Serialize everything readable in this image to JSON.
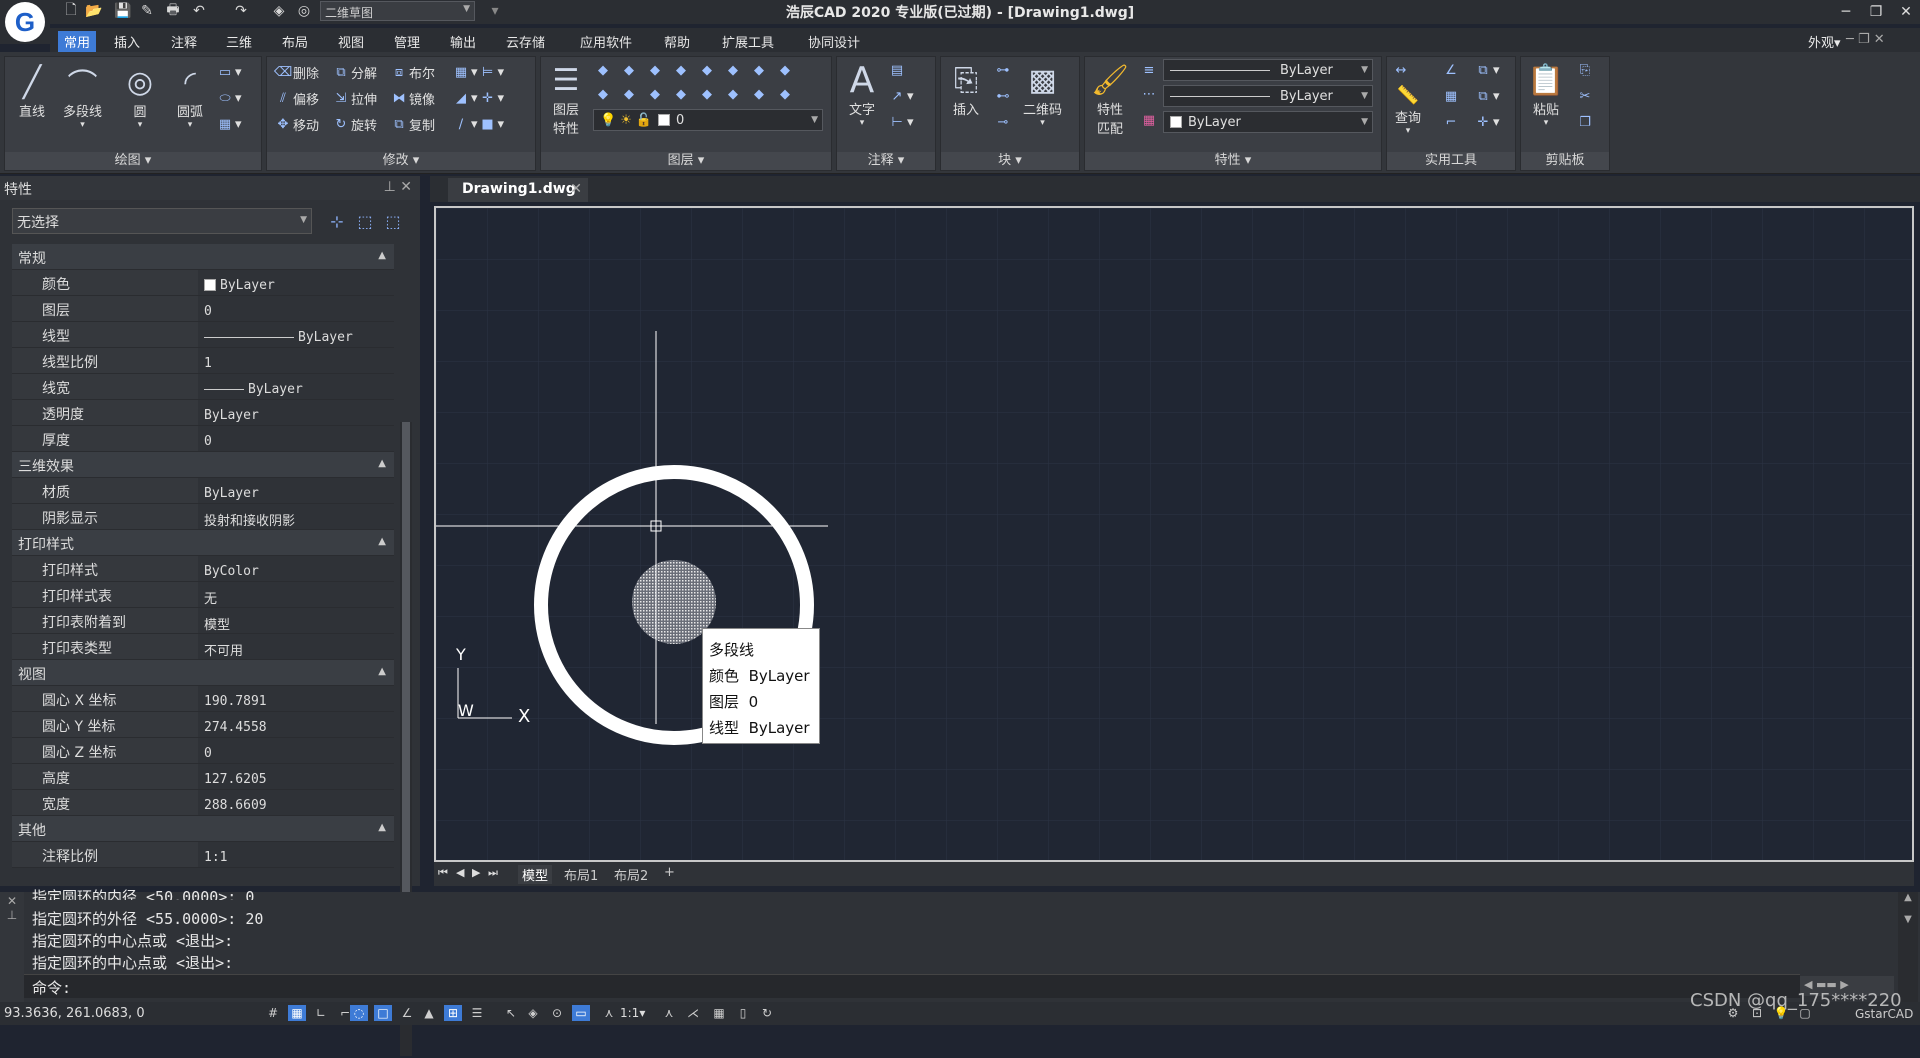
{
  "titlebar": {
    "workspace": "二维草图",
    "title": "浩辰CAD 2020 专业版(已过期) - [Drawing1.dwg]"
  },
  "menus": [
    "常用",
    "插入",
    "注释",
    "三维",
    "布局",
    "视图",
    "管理",
    "输出",
    "云存储",
    "应用软件",
    "帮助",
    "扩展工具",
    "协同设计"
  ],
  "menu_right": "外观",
  "ribbon": {
    "draw": {
      "line": "直线",
      "polyline": "多段线",
      "circle": "圆",
      "arc": "圆弧",
      "title": "绘图"
    },
    "modify": {
      "erase": "删除",
      "explode": "分解",
      "boolean": "布尔",
      "offset": "偏移",
      "stretch": "拉伸",
      "mirror": "镜像",
      "move": "移动",
      "rotate": "旋转",
      "copy": "复制",
      "title": "修改"
    },
    "layer": {
      "props_l1": "图层",
      "props_l2": "特性",
      "current": "0",
      "title": "图层"
    },
    "annotate": {
      "text": "文字",
      "title": "注释"
    },
    "block": {
      "insert": "插入",
      "qrcode": "二维码",
      "title": "块"
    },
    "properties": {
      "match_l1": "特性",
      "match_l2": "匹配",
      "linetype1": "ByLayer",
      "linetype2": "ByLayer",
      "color": "ByLayer",
      "title": "特性"
    },
    "utilities": {
      "query": "查询",
      "title": "实用工具"
    },
    "clipboard": {
      "paste": "粘贴",
      "title": "剪贴板"
    }
  },
  "props_panel": {
    "title": "特性",
    "selection": "无选择",
    "sections": {
      "general": "常规",
      "effect3d": "三维效果",
      "plotstyle": "打印样式",
      "view": "视图",
      "misc": "其他"
    },
    "general": [
      {
        "k": "颜色",
        "v": "ByLayer"
      },
      {
        "k": "图层",
        "v": "0"
      },
      {
        "k": "线型",
        "v": "ByLayer"
      },
      {
        "k": "线型比例",
        "v": "1"
      },
      {
        "k": "线宽",
        "v": "ByLayer"
      },
      {
        "k": "透明度",
        "v": "ByLayer"
      },
      {
        "k": "厚度",
        "v": "0"
      }
    ],
    "effect3d": [
      {
        "k": "材质",
        "v": "ByLayer"
      },
      {
        "k": "阴影显示",
        "v": "投射和接收阴影"
      }
    ],
    "plotstyle": [
      {
        "k": "打印样式",
        "v": "ByColor"
      },
      {
        "k": "打印样式表",
        "v": "无"
      },
      {
        "k": "打印表附着到",
        "v": "模型"
      },
      {
        "k": "打印表类型",
        "v": "不可用"
      }
    ],
    "view": [
      {
        "k": "圆心 X 坐标",
        "v": "190.7891"
      },
      {
        "k": "圆心 Y 坐标",
        "v": "274.4558"
      },
      {
        "k": "圆心 Z 坐标",
        "v": "0"
      },
      {
        "k": "高度",
        "v": "127.6205"
      },
      {
        "k": "宽度",
        "v": "288.6609"
      }
    ],
    "misc": [
      {
        "k": "注释比例",
        "v": "1:1"
      }
    ]
  },
  "doc_tab": "Drawing1.dwg",
  "tooltip": {
    "type": "多段线",
    "color_k": "颜色",
    "color_v": "ByLayer",
    "layer_k": "图层",
    "layer_v": "0",
    "linetype_k": "线型",
    "linetype_v": "ByLayer"
  },
  "ucs": {
    "y": "Y",
    "w": "W",
    "x": "X"
  },
  "layout_tabs": [
    "模型",
    "布局1",
    "布局2",
    "+"
  ],
  "command": {
    "line0": "指定圆环的内径 <50.0000>: 0",
    "line1": "指定圆环的外径 <55.0000>: 20",
    "line2": "指定圆环的中心点或 <退出>:",
    "line3": "指定圆环的中心点或 <退出>:",
    "prompt": "命令:"
  },
  "status": {
    "coords": "93.3636, 261.0683, 0",
    "scale": "1:1",
    "brand": "GstarCAD"
  },
  "watermark": "CSDN @qq_175****220"
}
